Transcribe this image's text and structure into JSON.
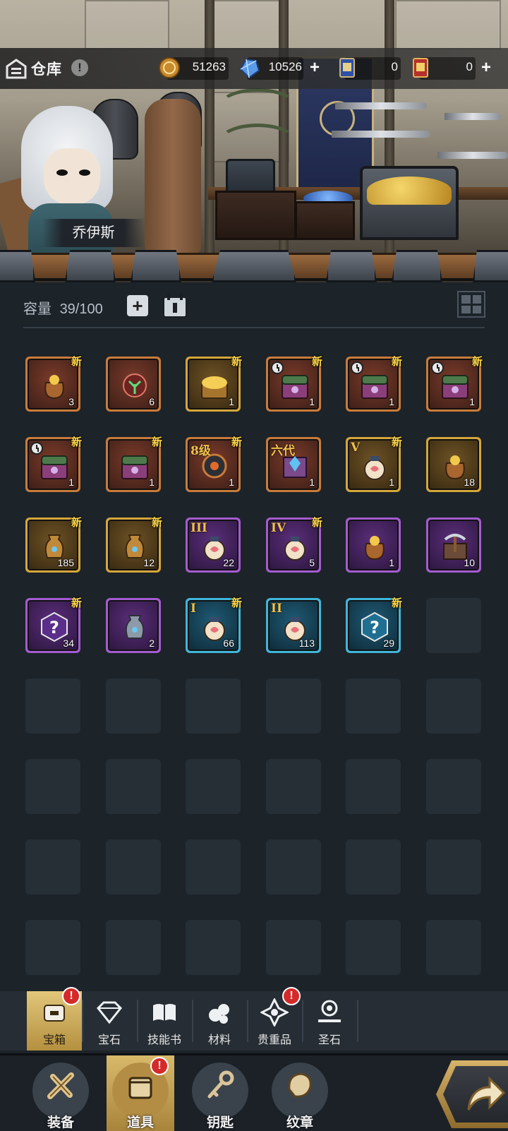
{
  "header": {
    "title": "仓库",
    "info_glyph": "!",
    "currencies": [
      {
        "name": "coin",
        "icon": "gold-coin-icon",
        "value": "51263",
        "has_plus": false
      },
      {
        "name": "crystal",
        "icon": "blue-crystal-icon",
        "value": "10526",
        "has_plus": true
      },
      {
        "name": "ticket",
        "icon": "blue-ticket-icon",
        "value": "0",
        "has_plus": false
      },
      {
        "name": "gold-ticket",
        "icon": "red-gold-ticket-icon",
        "value": "0",
        "has_plus": true
      }
    ]
  },
  "hero": {
    "name": "乔伊斯"
  },
  "capacity": {
    "label": "容量",
    "value": "39/100",
    "plus": "+"
  },
  "items": [
    {
      "rarity": "orange",
      "icon": "flower-sack-icon",
      "count": "3",
      "new": true,
      "timer": false,
      "tier": ""
    },
    {
      "rarity": "orange",
      "icon": "mystery-herb-icon",
      "count": "6",
      "new": false,
      "timer": false,
      "tier": ""
    },
    {
      "rarity": "gold",
      "icon": "treasure-chest-icon",
      "count": "1",
      "new": true,
      "timer": false,
      "tier": ""
    },
    {
      "rarity": "orange",
      "icon": "timed-chest-icon",
      "count": "1",
      "new": true,
      "timer": true,
      "tier": ""
    },
    {
      "rarity": "orange",
      "icon": "timed-chest-icon",
      "count": "1",
      "new": true,
      "timer": true,
      "tier": ""
    },
    {
      "rarity": "orange",
      "icon": "timed-chest-icon",
      "count": "1",
      "new": true,
      "timer": true,
      "tier": ""
    },
    {
      "rarity": "orange",
      "icon": "timed-chest-icon",
      "count": "1",
      "new": true,
      "timer": true,
      "tier": ""
    },
    {
      "rarity": "orange",
      "icon": "purple-chest-icon",
      "count": "1",
      "new": true,
      "timer": false,
      "tier": ""
    },
    {
      "rarity": "orange",
      "icon": "level-8-orb-icon",
      "count": "1",
      "new": true,
      "timer": false,
      "tier": "8级"
    },
    {
      "rarity": "orange",
      "icon": "sixth-gen-gem-icon",
      "count": "1",
      "new": false,
      "timer": false,
      "tier": "六代"
    },
    {
      "rarity": "gold",
      "icon": "pouch-v-icon",
      "count": "1",
      "new": true,
      "timer": false,
      "tier": "V"
    },
    {
      "rarity": "gold",
      "icon": "gold-sack-icon",
      "count": "18",
      "new": false,
      "timer": false,
      "tier": ""
    },
    {
      "rarity": "gold",
      "icon": "golden-urn-icon",
      "count": "185",
      "new": true,
      "timer": false,
      "tier": ""
    },
    {
      "rarity": "gold",
      "icon": "golden-urn-icon",
      "count": "12",
      "new": true,
      "timer": false,
      "tier": ""
    },
    {
      "rarity": "purple",
      "icon": "pouch-iii-icon",
      "count": "22",
      "new": false,
      "timer": false,
      "tier": "III"
    },
    {
      "rarity": "purple",
      "icon": "pouch-iv-icon",
      "count": "5",
      "new": true,
      "timer": false,
      "tier": "IV"
    },
    {
      "rarity": "purple",
      "icon": "gold-sack-icon",
      "count": "1",
      "new": false,
      "timer": false,
      "tier": ""
    },
    {
      "rarity": "purple",
      "icon": "pickaxe-crate-icon",
      "count": "10",
      "new": false,
      "timer": false,
      "tier": ""
    },
    {
      "rarity": "purple",
      "icon": "purple-mystery-icon",
      "count": "34",
      "new": true,
      "timer": false,
      "tier": ""
    },
    {
      "rarity": "purple",
      "icon": "silver-urn-icon",
      "count": "2",
      "new": false,
      "timer": false,
      "tier": ""
    },
    {
      "rarity": "blue",
      "icon": "pouch-i-icon",
      "count": "66",
      "new": true,
      "timer": false,
      "tier": "I"
    },
    {
      "rarity": "blue",
      "icon": "pouch-ii-icon",
      "count": "113",
      "new": false,
      "timer": false,
      "tier": "II"
    },
    {
      "rarity": "blue",
      "icon": "blue-mystery-icon",
      "count": "29",
      "new": true,
      "timer": false,
      "tier": ""
    }
  ],
  "new_badge": "新",
  "categories": [
    {
      "label": "宝箱",
      "icon": "chest-tab-icon",
      "active": true,
      "alert": true
    },
    {
      "label": "宝石",
      "icon": "diamond-tab-icon",
      "active": false,
      "alert": false
    },
    {
      "label": "技能书",
      "icon": "book-tab-icon",
      "active": false,
      "alert": false
    },
    {
      "label": "材料",
      "icon": "ore-tab-icon",
      "active": false,
      "alert": false
    },
    {
      "label": "贵重品",
      "icon": "star-gem-tab-icon",
      "active": false,
      "alert": true
    },
    {
      "label": "圣石",
      "icon": "holy-stone-tab-icon",
      "active": false,
      "alert": false
    }
  ],
  "nav": [
    {
      "label": "装备",
      "icon": "equipment-nav-icon",
      "active": false,
      "alert": false
    },
    {
      "label": "道具",
      "icon": "items-nav-icon",
      "active": true,
      "alert": true
    },
    {
      "label": "钥匙",
      "icon": "key-nav-icon",
      "active": false,
      "alert": false
    },
    {
      "label": "纹章",
      "icon": "emblem-nav-icon",
      "active": false,
      "alert": false
    }
  ],
  "alert_glyph": "!",
  "colors": {
    "orange": "#c97b3a",
    "gold": "#d5a63a",
    "purple": "#a55bd1",
    "blue": "#3fb6d9",
    "accent": "#d8b96b",
    "alert": "#d42a2a"
  }
}
